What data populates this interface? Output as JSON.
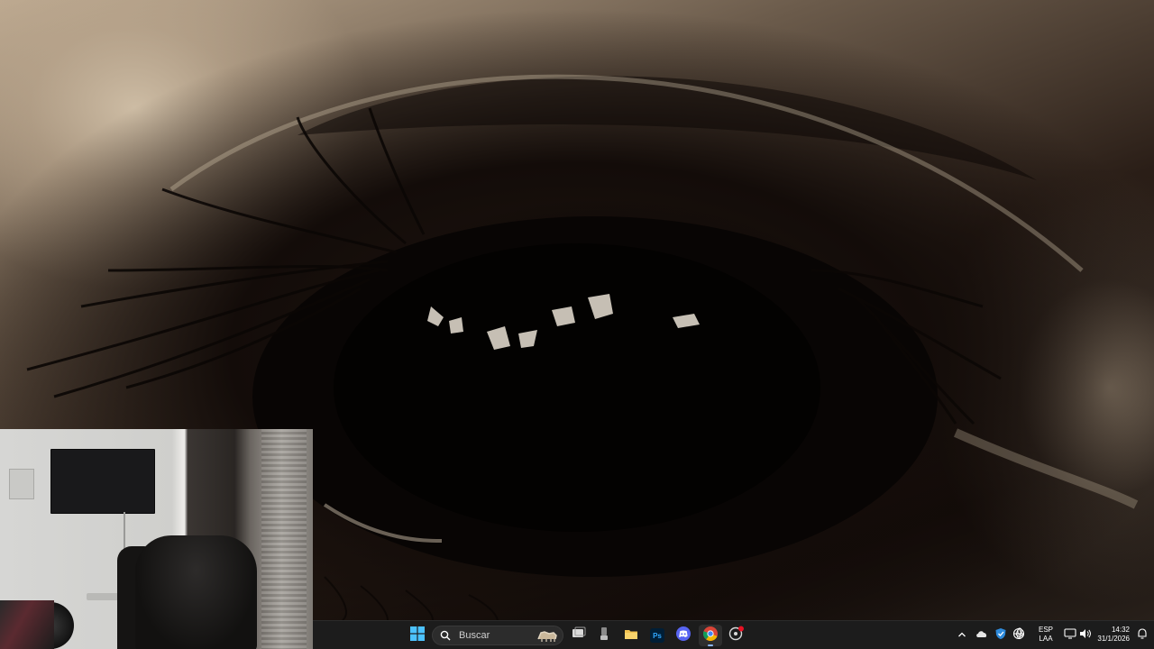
{
  "wallpaper": {
    "description_icon": "eye-wallpaper"
  },
  "webcam": {
    "icon": "webcam-feed"
  },
  "taskbar": {
    "start": {
      "icon": "windows-start-icon"
    },
    "search": {
      "placeholder": "Buscar",
      "icon": "search-icon"
    },
    "apps": [
      {
        "name": "task-view",
        "icon": "task-view-icon"
      },
      {
        "name": "unknown-app",
        "icon": "app-icon"
      },
      {
        "name": "file-explorer",
        "icon": "folder-icon"
      },
      {
        "name": "photoshop",
        "label": "Ps",
        "icon": "photoshop-icon"
      },
      {
        "name": "discord",
        "icon": "discord-icon"
      },
      {
        "name": "chrome",
        "icon": "chrome-icon",
        "active": true
      },
      {
        "name": "obs-like",
        "icon": "recorder-icon"
      }
    ],
    "tray": {
      "lang_line1": "ESP",
      "lang_line2": "LAA",
      "time": "14:32",
      "date": "31/1/2026"
    }
  },
  "colors": {
    "taskbar_bg": "#1c1c1c",
    "accent": "#8cb7ff",
    "photoshop": "#31a8ff",
    "discord": "#5865f2"
  }
}
